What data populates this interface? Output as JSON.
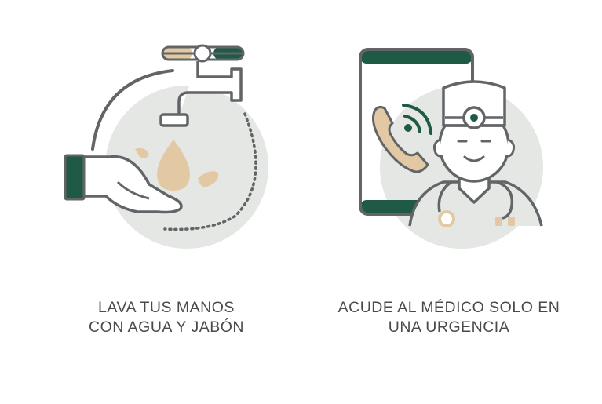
{
  "colors": {
    "outline": "#626467",
    "green": "#1e5a46",
    "beige": "#e3c9a3",
    "circle": "#e4e7e4"
  },
  "tips": [
    {
      "icon": "handwash-icon",
      "line1": "LAVA TUS MANOS",
      "line2": "CON AGUA Y JABÓN"
    },
    {
      "icon": "doctor-call-icon",
      "line1": "ACUDE AL MÉDICO SOLO EN",
      "line2": "UNA URGENCIA"
    }
  ]
}
